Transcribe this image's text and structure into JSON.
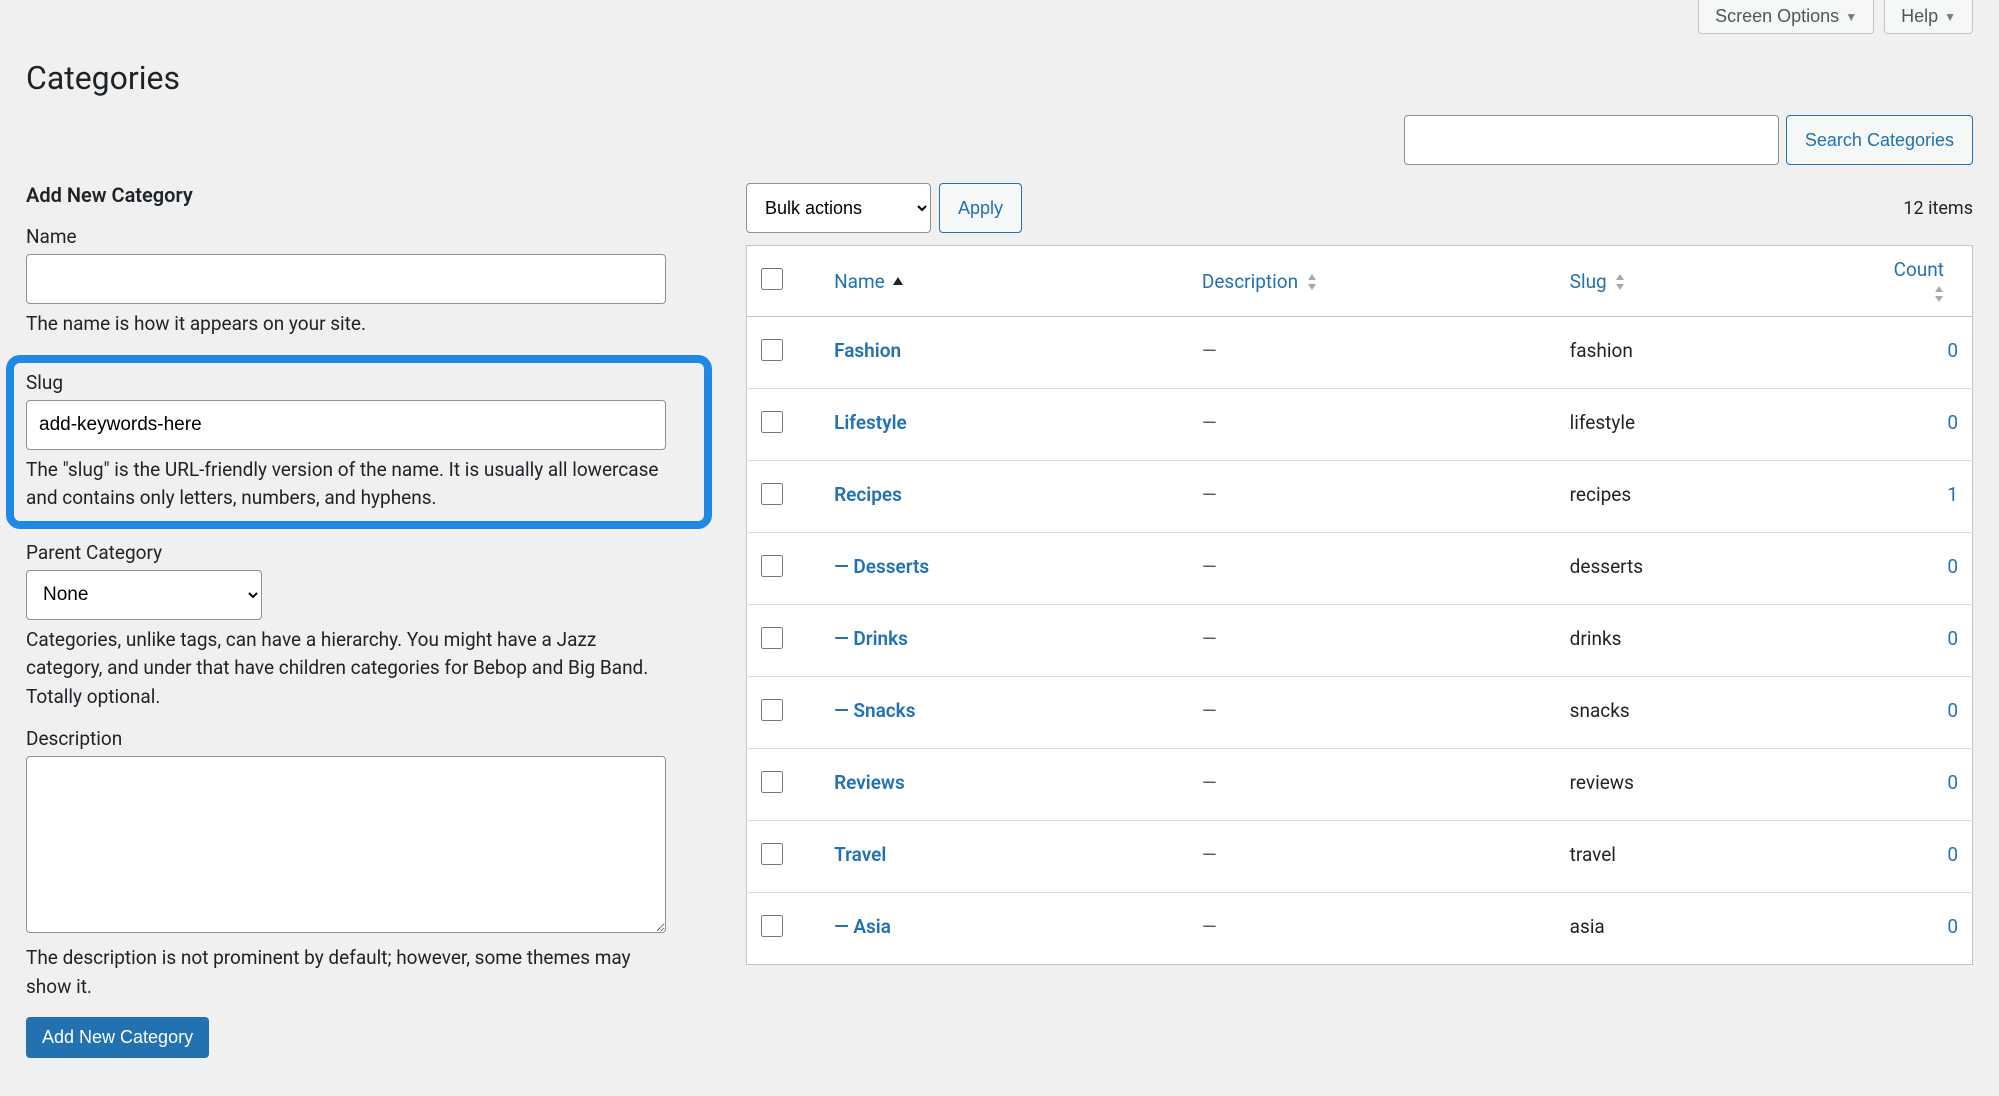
{
  "top": {
    "screen_options": "Screen Options",
    "help": "Help"
  },
  "page_title": "Categories",
  "search": {
    "button": "Search Categories"
  },
  "form": {
    "title": "Add New Category",
    "name_label": "Name",
    "name_value": "",
    "name_help": "The name is how it appears on your site.",
    "slug_label": "Slug",
    "slug_value": "add-keywords-here",
    "slug_help": "The \"slug\" is the URL-friendly version of the name. It is usually all lowercase and contains only letters, numbers, and hyphens.",
    "parent_label": "Parent Category",
    "parent_selected": "None",
    "parent_help": "Categories, unlike tags, can have a hierarchy. You might have a Jazz category, and under that have children categories for Bebop and Big Band. Totally optional.",
    "description_label": "Description",
    "description_value": "",
    "description_help": "The description is not prominent by default; however, some themes may show it.",
    "submit_label": "Add New Category"
  },
  "table": {
    "bulk_label": "Bulk actions",
    "apply_label": "Apply",
    "item_count": "12 items",
    "headers": {
      "name": "Name",
      "description": "Description",
      "slug": "Slug",
      "count": "Count"
    },
    "rows": [
      {
        "name": "Fashion",
        "description": "—",
        "slug": "fashion",
        "count": "0"
      },
      {
        "name": "Lifestyle",
        "description": "—",
        "slug": "lifestyle",
        "count": "0"
      },
      {
        "name": "Recipes",
        "description": "—",
        "slug": "recipes",
        "count": "1"
      },
      {
        "name": "— Desserts",
        "description": "—",
        "slug": "desserts",
        "count": "0"
      },
      {
        "name": "— Drinks",
        "description": "—",
        "slug": "drinks",
        "count": "0"
      },
      {
        "name": "— Snacks",
        "description": "—",
        "slug": "snacks",
        "count": "0"
      },
      {
        "name": "Reviews",
        "description": "—",
        "slug": "reviews",
        "count": "0"
      },
      {
        "name": "Travel",
        "description": "—",
        "slug": "travel",
        "count": "0"
      },
      {
        "name": "— Asia",
        "description": "—",
        "slug": "asia",
        "count": "0"
      }
    ]
  }
}
